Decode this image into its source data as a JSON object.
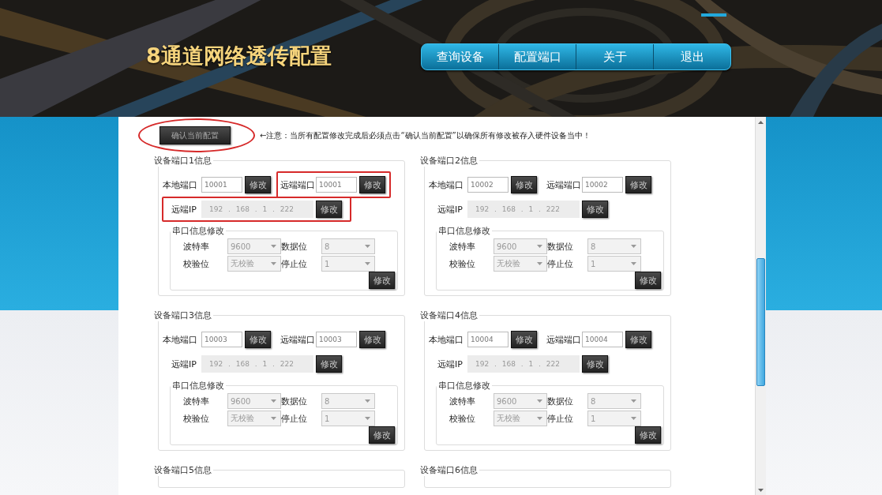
{
  "header": {
    "title": "8通道网络透传配置",
    "nav": [
      {
        "label": "查询设备"
      },
      {
        "label": "配置端口"
      },
      {
        "label": "关于"
      },
      {
        "label": "退出"
      }
    ]
  },
  "confirm": {
    "label": "确认当前配置",
    "highlighted": true,
    "note": "←注意：当所有配置修改完成后必须点击“确认当前配置”以确保所有修改被存入硬件设备当中！"
  },
  "ports": [
    {
      "legend": "设备端口1信息",
      "fields": [
        {
          "label": "本地端口",
          "value": "10001",
          "button": "修改",
          "highlighted": false
        },
        {
          "label": "远端端口",
          "value": "10001",
          "button": "修改",
          "highlighted": true
        }
      ],
      "ip": {
        "label": "远端IP",
        "value": "192 . 168 . 1 . 222",
        "button": "修改",
        "highlighted": true,
        "disabled": true
      },
      "serial": {
        "legend": "串口信息修改",
        "selects": [
          {
            "label": "波特率",
            "value": "9600",
            "disabled": true
          },
          {
            "label": "数据位",
            "value": "8",
            "disabled": true
          },
          {
            "label": "校验位",
            "value": "无校验",
            "disabled": true
          },
          {
            "label": "停止位",
            "value": "1",
            "disabled": true
          }
        ],
        "button": "修改"
      }
    },
    {
      "legend": "设备端口2信息",
      "fields": [
        {
          "label": "本地端口",
          "value": "10002",
          "button": "修改",
          "highlighted": false
        },
        {
          "label": "远端端口",
          "value": "10002",
          "button": "修改",
          "highlighted": false
        }
      ],
      "ip": {
        "label": "远端IP",
        "value": "192 . 168 . 1 . 222",
        "button": "修改",
        "highlighted": false,
        "disabled": true
      },
      "serial": {
        "legend": "串口信息修改",
        "selects": [
          {
            "label": "波特率",
            "value": "9600",
            "disabled": true
          },
          {
            "label": "数据位",
            "value": "8",
            "disabled": true
          },
          {
            "label": "校验位",
            "value": "无校验",
            "disabled": true
          },
          {
            "label": "停止位",
            "value": "1",
            "disabled": true
          }
        ],
        "button": "修改"
      }
    },
    {
      "legend": "设备端口3信息",
      "fields": [
        {
          "label": "本地端口",
          "value": "10003",
          "button": "修改",
          "highlighted": false
        },
        {
          "label": "远端端口",
          "value": "10003",
          "button": "修改",
          "highlighted": false
        }
      ],
      "ip": {
        "label": "远端IP",
        "value": "192 . 168 . 1 . 222",
        "button": "修改",
        "highlighted": false,
        "disabled": true
      },
      "serial": {
        "legend": "串口信息修改",
        "selects": [
          {
            "label": "波特率",
            "value": "9600",
            "disabled": true
          },
          {
            "label": "数据位",
            "value": "8",
            "disabled": true
          },
          {
            "label": "校验位",
            "value": "无校验",
            "disabled": true
          },
          {
            "label": "停止位",
            "value": "1",
            "disabled": true
          }
        ],
        "button": "修改"
      }
    },
    {
      "legend": "设备端口4信息",
      "fields": [
        {
          "label": "本地端口",
          "value": "10004",
          "button": "修改",
          "highlighted": false
        },
        {
          "label": "远端端口",
          "value": "10004",
          "button": "修改",
          "highlighted": false
        }
      ],
      "ip": {
        "label": "远端IP",
        "value": "192 . 168 . 1 . 222",
        "button": "修改",
        "highlighted": false,
        "disabled": true
      },
      "serial": {
        "legend": "串口信息修改",
        "selects": [
          {
            "label": "波特率",
            "value": "9600",
            "disabled": true
          },
          {
            "label": "数据位",
            "value": "8",
            "disabled": true
          },
          {
            "label": "校验位",
            "value": "无校验",
            "disabled": true
          },
          {
            "label": "停止位",
            "value": "1",
            "disabled": true
          }
        ],
        "button": "修改"
      }
    },
    {
      "legend": "设备端口5信息"
    },
    {
      "legend": "设备端口6信息"
    }
  ]
}
